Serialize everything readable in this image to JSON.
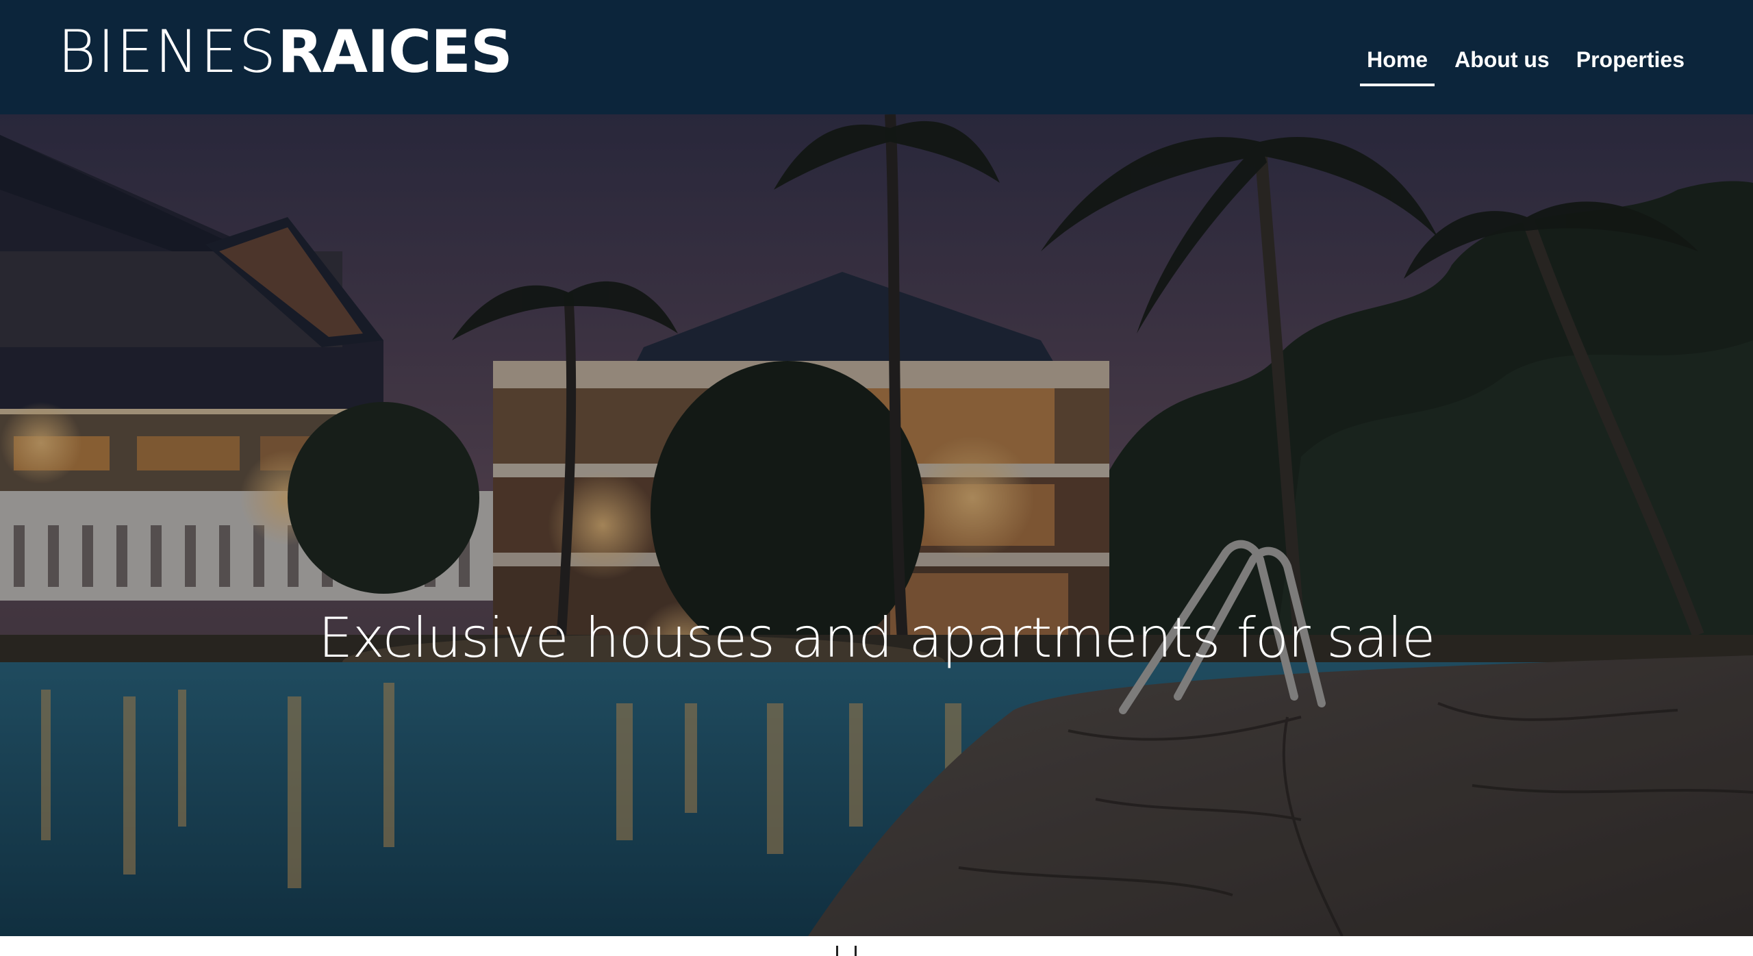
{
  "header": {
    "logo_light": "BIENES",
    "logo_bold": "RAICES",
    "background_color": "#0c253b"
  },
  "nav": {
    "items": [
      {
        "label": "Home",
        "active": true
      },
      {
        "label": "About us",
        "active": false
      },
      {
        "label": "Properties",
        "active": false
      }
    ]
  },
  "hero": {
    "title": "Exclusive houses and apartments for sale",
    "image": "night-resort-with-pool-and-palm-trees"
  }
}
